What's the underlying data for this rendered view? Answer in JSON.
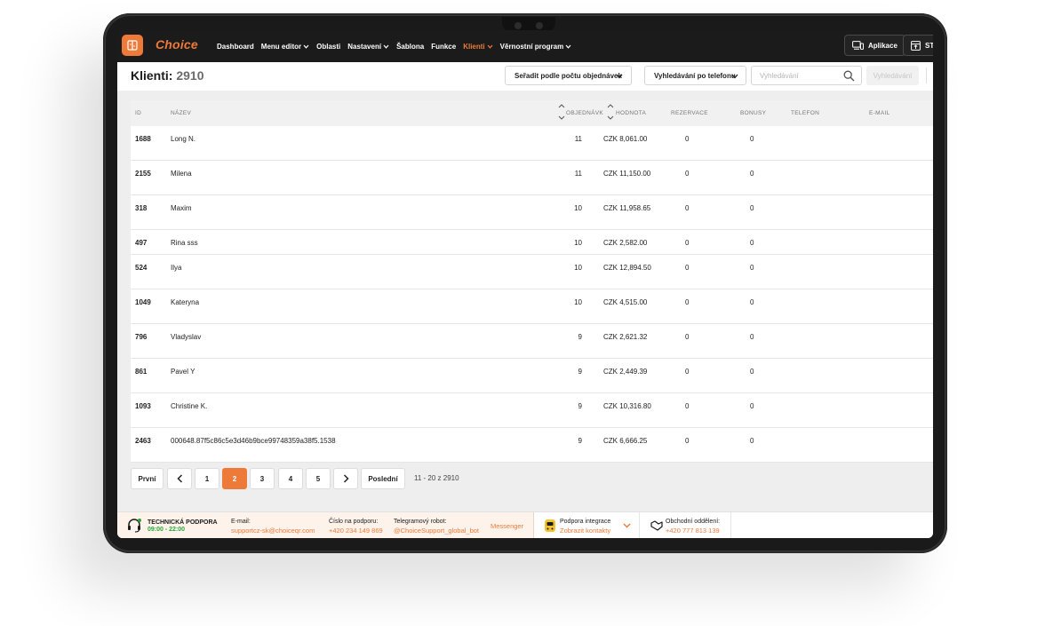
{
  "app": {
    "brand": "Choice"
  },
  "nav": {
    "items": [
      {
        "label": "Dashboard",
        "dropdown": false,
        "active": false
      },
      {
        "label": "Menu editor",
        "dropdown": true,
        "active": false
      },
      {
        "label": "Oblasti",
        "dropdown": false,
        "active": false
      },
      {
        "label": "Nastavení",
        "dropdown": true,
        "active": false
      },
      {
        "label": "Šablona",
        "dropdown": false,
        "active": false
      },
      {
        "label": "Funkce",
        "dropdown": false,
        "active": false
      },
      {
        "label": "Klienti",
        "dropdown": true,
        "active": true
      },
      {
        "label": "Věrnostní program",
        "dropdown": true,
        "active": false
      }
    ],
    "apps_button": "Aplikace",
    "truncated_button": "ST"
  },
  "header": {
    "title": "Klienti:",
    "count": "2910",
    "sort_dropdown": "Seřadit podle počtu objednávek",
    "search_mode_dropdown": "Vyhledávání po telefonu",
    "search_placeholder": "Vyhledávání",
    "search_button": "Vyhledávání"
  },
  "table": {
    "columns": [
      "ID",
      "NÁZEV",
      "OBJEDNÁVK",
      "HODNOTA",
      "REZERVACE",
      "BONUSY",
      "TELEFON",
      "E-MAIL"
    ],
    "rows": [
      {
        "id": "1688",
        "name": "Long N.",
        "orders": "11",
        "value": "CZK 8,061.00",
        "reservations": "0",
        "bonuses": "0",
        "tall": true
      },
      {
        "id": "2155",
        "name": "Milena",
        "orders": "11",
        "value": "CZK 11,150.00",
        "reservations": "0",
        "bonuses": "0",
        "tall": true
      },
      {
        "id": "318",
        "name": "Maxim",
        "orders": "10",
        "value": "CZK 11,958.65",
        "reservations": "0",
        "bonuses": "0",
        "tall": true
      },
      {
        "id": "497",
        "name": "Rina sss",
        "orders": "10",
        "value": "CZK 2,582.00",
        "reservations": "0",
        "bonuses": "0",
        "tall": false
      },
      {
        "id": "524",
        "name": "Ilya",
        "orders": "10",
        "value": "CZK 12,894.50",
        "reservations": "0",
        "bonuses": "0",
        "tall": true
      },
      {
        "id": "1049",
        "name": "Kateryna",
        "orders": "10",
        "value": "CZK 4,515.00",
        "reservations": "0",
        "bonuses": "0",
        "tall": true
      },
      {
        "id": "796",
        "name": "Vladyslav",
        "orders": "9",
        "value": "CZK 2,621.32",
        "reservations": "0",
        "bonuses": "0",
        "tall": true
      },
      {
        "id": "861",
        "name": "Pavel Y",
        "orders": "9",
        "value": "CZK 2,449.39",
        "reservations": "0",
        "bonuses": "0",
        "tall": true
      },
      {
        "id": "1093",
        "name": "Christine K.",
        "orders": "9",
        "value": "CZK 10,316.80",
        "reservations": "0",
        "bonuses": "0",
        "tall": true
      },
      {
        "id": "2463",
        "name": "000648.87f5c86c5e3d46b9bce99748359a38f5.1538",
        "orders": "9",
        "value": "CZK 6,666.25",
        "reservations": "0",
        "bonuses": "0",
        "tall": true
      }
    ]
  },
  "pagination": {
    "first": "První",
    "prev_icon": "chevron-left-icon",
    "pages": [
      "1",
      "2",
      "3",
      "4",
      "5"
    ],
    "current": "2",
    "next_icon": "chevron-right-icon",
    "last": "Poslední",
    "info": "11 - 20 z 2910"
  },
  "footer": {
    "support_title": "TECHNICKÁ PODPORA",
    "support_hours": "09:00 - 22:00",
    "email_label": "E-mail:",
    "email_value": "supportcz-sk@choiceqr.com",
    "phone_label": "Číslo na podporu:",
    "phone_value": "+420 234 149 869",
    "telegram_label": "Telegramový robot:",
    "telegram_value": "@ChoiceSupport_global_bot",
    "messenger": "Messenger",
    "integration_label": "Podpora integrace",
    "integration_link": "Zobrazit kontakty",
    "sales_label": "Obchodní oddělení:",
    "sales_phone": "+420 777 813 139"
  },
  "colors": {
    "accent": "#ee7a3a",
    "nav_bg": "#1b1b1b",
    "content_bg": "#eeeeee",
    "green": "#2aa53a"
  }
}
